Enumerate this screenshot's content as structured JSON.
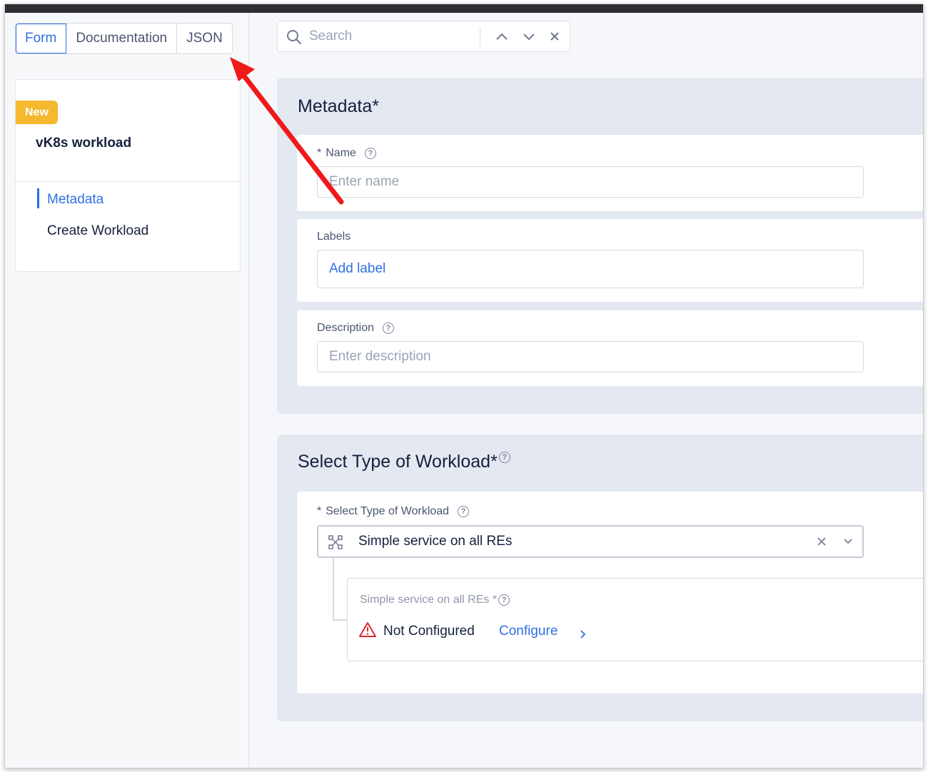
{
  "tabs": [
    {
      "label": "Form"
    },
    {
      "label": "Documentation"
    },
    {
      "label": "JSON"
    }
  ],
  "card": {
    "badge": "New",
    "title": "vK8s workload",
    "nav": [
      {
        "label": "Metadata"
      },
      {
        "label": "Create Workload"
      }
    ]
  },
  "search": {
    "placeholder": "Search"
  },
  "metadata": {
    "title": "Metadata",
    "required_mark": "*",
    "name_label": "Name",
    "name_required": "*",
    "name_placeholder": "Enter name",
    "labels_label": "Labels",
    "add_label": "Add label",
    "description_label": "Description",
    "description_placeholder": "Enter description"
  },
  "workload": {
    "title": "Select Type of Workload",
    "required_mark": "*",
    "field_label": "Select Type of Workload",
    "field_required": "*",
    "selected": "Simple service on all REs",
    "sub_label": "Simple service on all REs",
    "sub_required": "*",
    "status": "Not Configured",
    "configure": "Configure"
  },
  "colors": {
    "accent": "#2f6fe4",
    "badge": "#f5b82e",
    "warning": "#e0282c",
    "annotation_arrow": "#f01919"
  }
}
